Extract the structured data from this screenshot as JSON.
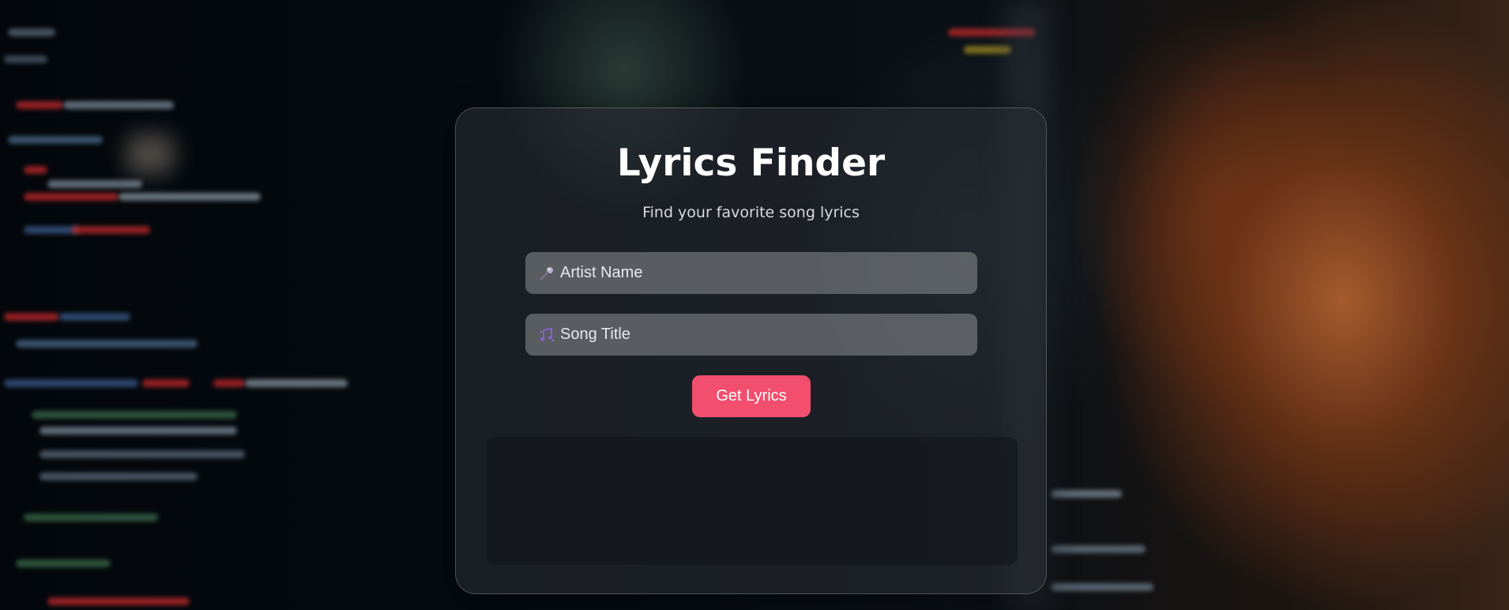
{
  "app": {
    "title": "Lyrics Finder",
    "subtitle": "Find your favorite song lyrics"
  },
  "form": {
    "artist": {
      "placeholder": "Artist Name",
      "value": "",
      "icon": "microphone-icon"
    },
    "song": {
      "placeholder": "Song Title",
      "value": "",
      "icon": "musical-notes-icon"
    },
    "submit_label": "Get Lyrics"
  },
  "results": {
    "text": ""
  },
  "colors": {
    "accent": "#f24e6e",
    "card_background": "#282c32",
    "title_text": "#ffffff",
    "subtitle_text": "#d8dade",
    "field_background": "#8c9096",
    "results_background": "#14161a"
  }
}
